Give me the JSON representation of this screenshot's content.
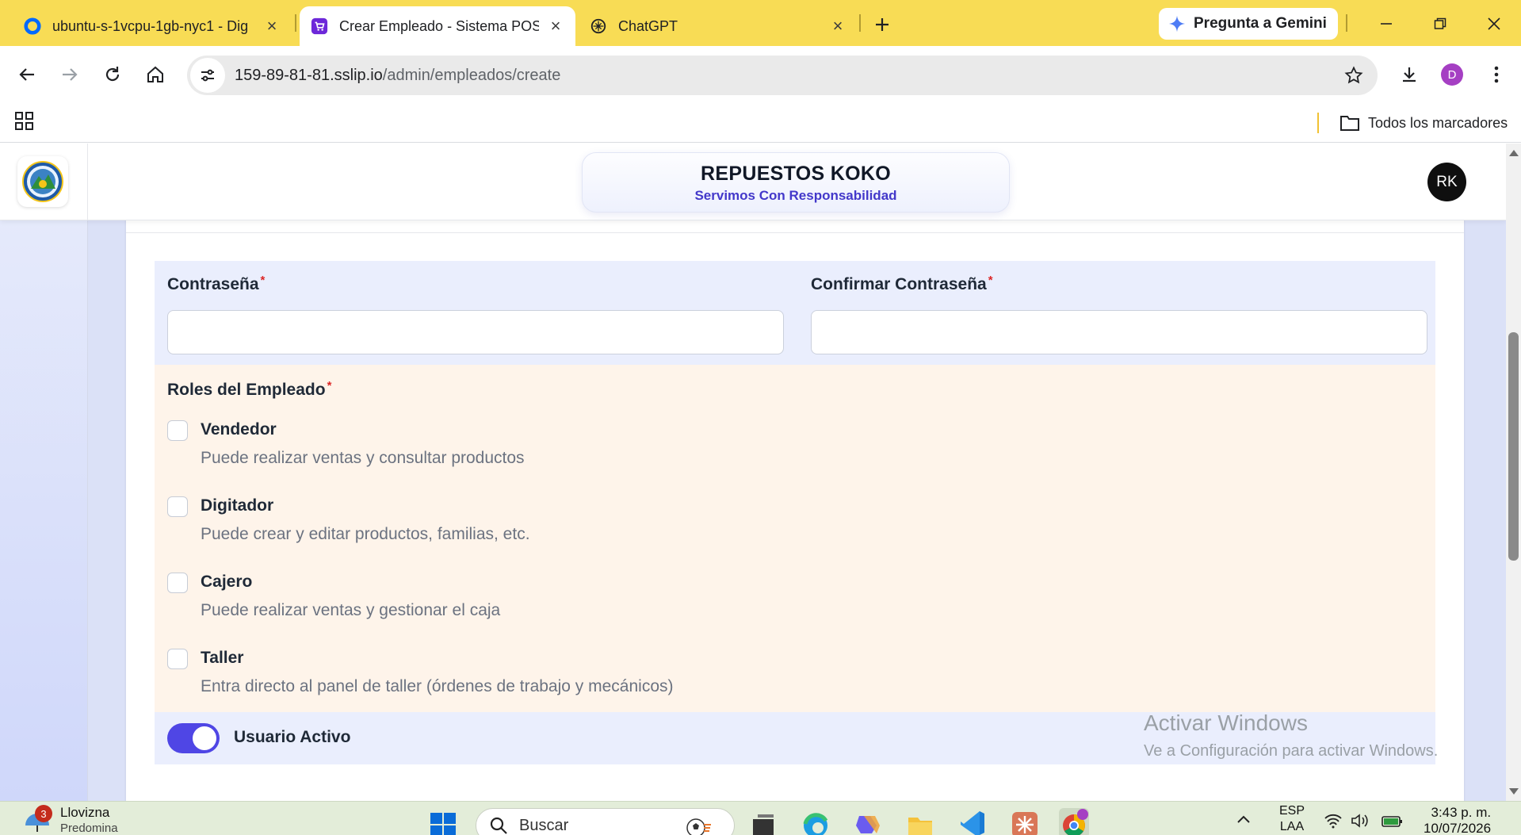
{
  "browser": {
    "tabs": [
      {
        "title": "ubuntu-s-1vcpu-1gb-nyc1 - Dig",
        "active": false
      },
      {
        "title": "Crear Empleado - Sistema POS",
        "active": true
      },
      {
        "title": "ChatGPT",
        "active": false
      }
    ],
    "gemini_label": "Pregunta a Gemini",
    "url_host": "159-89-81-81.sslip.io",
    "url_path": "/admin/empleados/create",
    "profile_initial": "D",
    "bookmarks_folder": "Todos los marcadores"
  },
  "app": {
    "brand_title": "REPUESTOS KOKO",
    "brand_subtitle": "Servimos Con Responsabilidad",
    "user_initials": "RK",
    "form": {
      "password_label": "Contraseña",
      "password_value": "",
      "confirm_password_label": "Confirmar Contraseña",
      "confirm_password_value": "",
      "required_mark": "*",
      "roles_label": "Roles del Empleado",
      "roles": [
        {
          "name": "Vendedor",
          "description": "Puede realizar ventas y consultar productos",
          "checked": false
        },
        {
          "name": "Digitador",
          "description": "Puede crear y editar productos, familias, etc.",
          "checked": false
        },
        {
          "name": "Cajero",
          "description": "Puede realizar ventas y gestionar el caja",
          "checked": false
        },
        {
          "name": "Taller",
          "description": "Entra directo al panel de taller (órdenes de trabajo y mecánicos)",
          "checked": false
        }
      ],
      "active_user_label": "Usuario Activo",
      "active_user_on": true
    }
  },
  "watermark": {
    "title": "Activar Windows",
    "subtitle": "Ve a Configuración para activar Windows."
  },
  "taskbar": {
    "weather_badge": "3",
    "weather_text": "Llovizna",
    "weather_sub": "Predomina",
    "search_placeholder": "Buscar",
    "language_top": "ESP",
    "language_bottom": "LAA",
    "time": "3:43 p. m.",
    "date": "10/07/2026"
  },
  "colors": {
    "tabstrip": "#f8dc55",
    "accent": "#4f46e5",
    "brand_subtitle": "#4338ca",
    "required": "#dc2626",
    "password_bg": "#eaeefd",
    "roles_bg": "#fef4ea"
  }
}
